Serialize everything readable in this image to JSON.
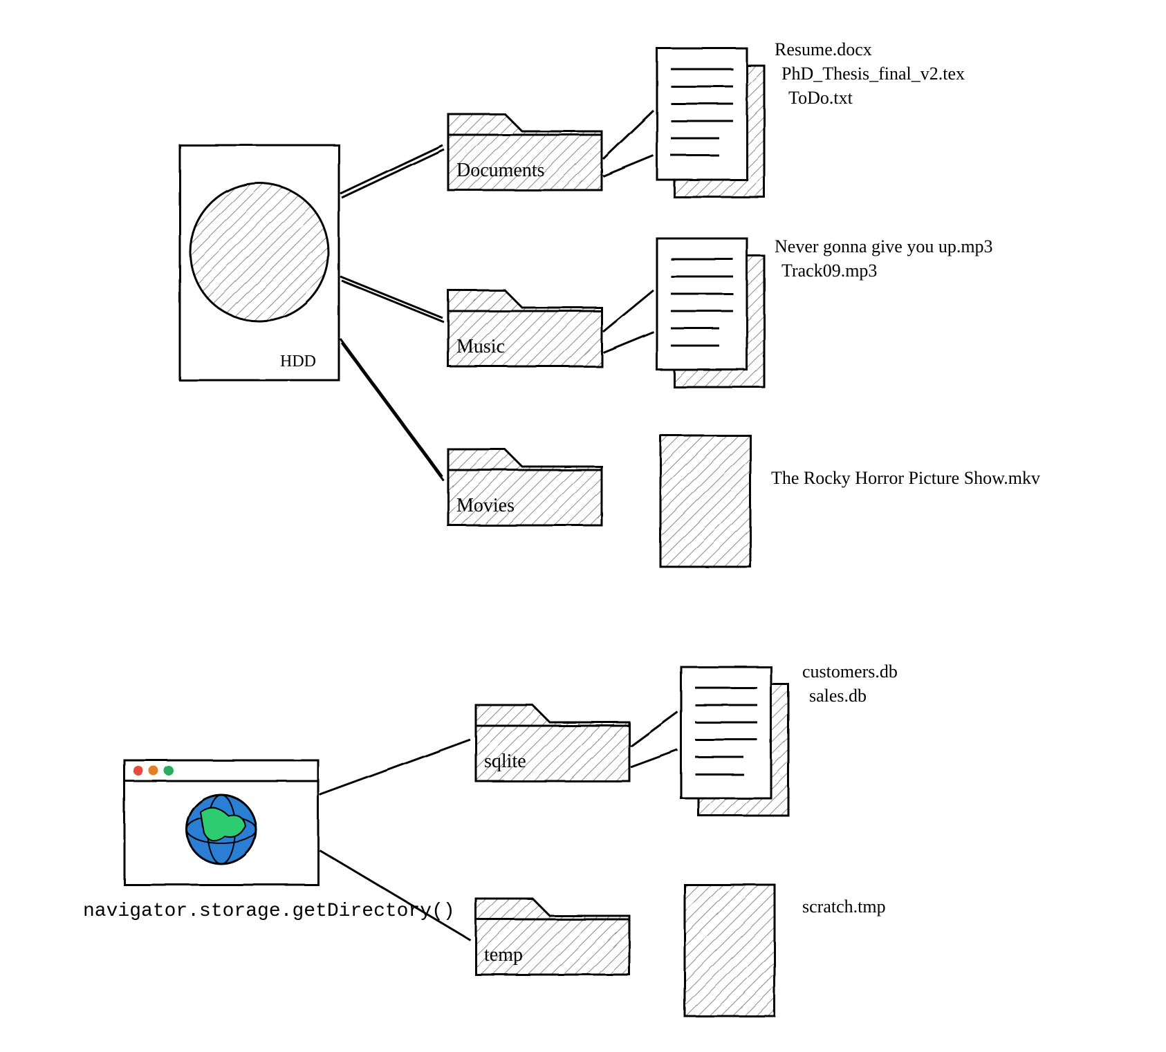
{
  "hdd": {
    "label": "HDD",
    "folders": [
      {
        "name": "Documents",
        "files": [
          "Resume.docx",
          "PhD_Thesis_final_v2.tex",
          "ToDo.txt"
        ]
      },
      {
        "name": "Music",
        "files": [
          "Never gonna give you up.mp3",
          "Track09.mp3"
        ]
      },
      {
        "name": "Movies",
        "files": [
          "The Rocky Horror Picture Show.mkv"
        ]
      }
    ]
  },
  "browser": {
    "api_label": "navigator.storage.getDirectory()",
    "folders": [
      {
        "name": "sqlite",
        "files": [
          "customers.db",
          "sales.db"
        ]
      },
      {
        "name": "temp",
        "files": [
          "scratch.tmp"
        ]
      }
    ]
  }
}
